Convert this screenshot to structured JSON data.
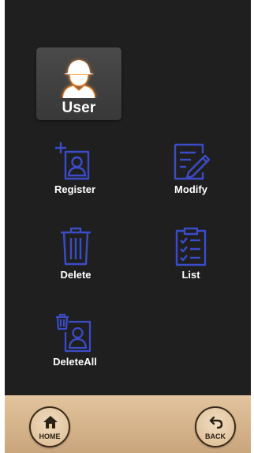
{
  "user_tile": {
    "label": "User",
    "icon": "user-avatar-icon"
  },
  "actions": {
    "register": {
      "label": "Register",
      "icon": "add-user-icon"
    },
    "modify": {
      "label": "Modify",
      "icon": "edit-document-icon"
    },
    "delete": {
      "label": "Delete",
      "icon": "trash-icon"
    },
    "list": {
      "label": "List",
      "icon": "clipboard-checklist-icon"
    },
    "delete_all": {
      "label": "DeleteAll",
      "icon": "delete-all-users-icon"
    }
  },
  "nav": {
    "home": {
      "label": "HOME",
      "icon": "home-icon"
    },
    "back": {
      "label": "BACK",
      "icon": "back-arrow-icon"
    }
  },
  "colors": {
    "background": "#1f1f1f",
    "icon_stroke": "#3c4cc8",
    "avatar_glow": "#ff8a2a",
    "bottom_bar": "#d7b68e"
  }
}
